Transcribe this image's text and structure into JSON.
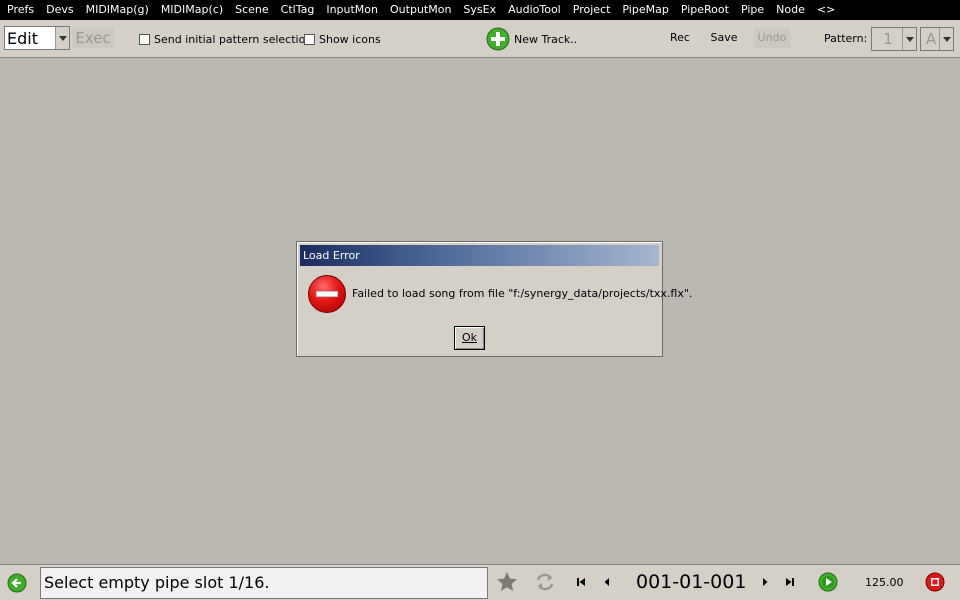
{
  "menu": [
    "Prefs",
    "Devs",
    "MIDIMap(g)",
    "MIDIMap(c)",
    "Scene",
    "CtlTag",
    "InputMon",
    "OutputMon",
    "SysEx",
    "AudioTool",
    "Project",
    "PipeMap",
    "PipeRoot",
    "Pipe",
    "Node",
    "<>"
  ],
  "toolbar": {
    "mode_value": "Edit",
    "exec_label": "Exec",
    "send_initial_label": "Send initial pattern selection",
    "show_icons_label": "Show icons",
    "new_track_label": "New Track..",
    "rec_label": "Rec",
    "save_label": "Save",
    "undo_label": "Undo",
    "pattern_label": "Pattern:",
    "pattern_number": "1",
    "pattern_letter": "A"
  },
  "dialog": {
    "title": "Load Error",
    "message": "Failed to load song from file \"f:/synergy_data/projects/txx.flx\".",
    "ok_label": "Ok"
  },
  "status": {
    "text": "Select empty pipe slot 1/16.",
    "position": "001-01-001",
    "tempo": "125.00"
  },
  "colors": {
    "background": "#bab7b0",
    "menubar": "#000000",
    "accent_green": "#3fae2a",
    "error_red": "#e31616"
  }
}
